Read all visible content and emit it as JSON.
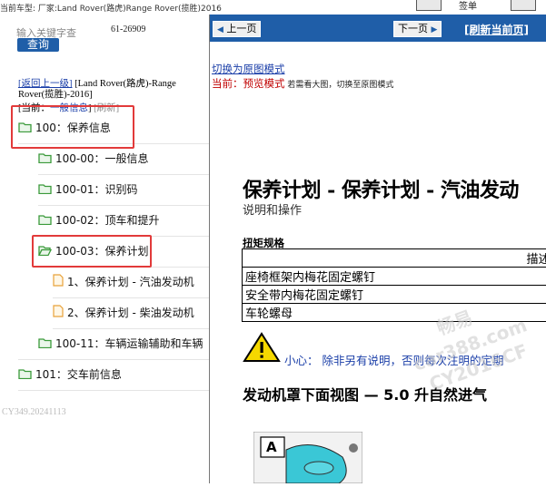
{
  "topbar": {
    "text": "当前车型: 厂家:Land Rover(路虎)Range Rover(揽胜)2016",
    "right_label": "签单"
  },
  "left": {
    "search_placeholder": "输入关键字查",
    "search_button": "查询",
    "visit_count": "61-26909",
    "back_link": "[返回上一级]",
    "back_model": "[Land Rover(路虎)-Range Rover(揽胜)-2016]",
    "current_prefix": "[当前：",
    "current_value": "一般信息",
    "current_suffix": "]",
    "refresh_small": "[刷新]",
    "tree": [
      {
        "label": "100：保养信息",
        "type": "folder"
      },
      {
        "label": "100-00：一般信息",
        "type": "folder"
      },
      {
        "label": "100-01：识别码",
        "type": "folder"
      },
      {
        "label": "100-02：顶车和提升",
        "type": "folder"
      },
      {
        "label": "100-03：保养计划",
        "type": "folder"
      },
      {
        "label": "1、保养计划 - 汽油发动机",
        "type": "file"
      },
      {
        "label": "2、保养计划 - 柴油发动机",
        "type": "file"
      },
      {
        "label": "100-11：车辆运输辅助和车辆",
        "type": "folder"
      },
      {
        "label": "101：交车前信息",
        "type": "folder"
      }
    ],
    "watermark": "CY349.20241113"
  },
  "nav": {
    "prev": "上一页",
    "next": "下一页",
    "refresh": "[刷新当前页]"
  },
  "doc": {
    "switch_link": "切换为原图模式",
    "mode_label": "当前：预览模式",
    "mode_hint": "若需看大图，切换至原图模式",
    "title": "保养计划 - 保养计划 - 汽油发动",
    "subtitle": "说明和操作",
    "torque_label": "扭矩规格",
    "torque_header": "描述",
    "torque_rows": [
      "座椅框架内梅花固定螺钉",
      "安全带内梅花固定螺钉",
      "车轮螺母"
    ],
    "caution": "小心：",
    "caution_text": "除非另有说明，否则每次注明的定期",
    "section": "发动机罩下面视图 — 5.0 升自然进气",
    "figure_label": "A",
    "watermarks": [
      "畅易",
      "car388.com",
      "CY2016CF"
    ]
  },
  "colors": {
    "nav_blue": "#1f5ea8",
    "highlight_red": "#e23a3a",
    "folder_green": "#3a9a3a",
    "file_orange": "#e8a23a"
  }
}
